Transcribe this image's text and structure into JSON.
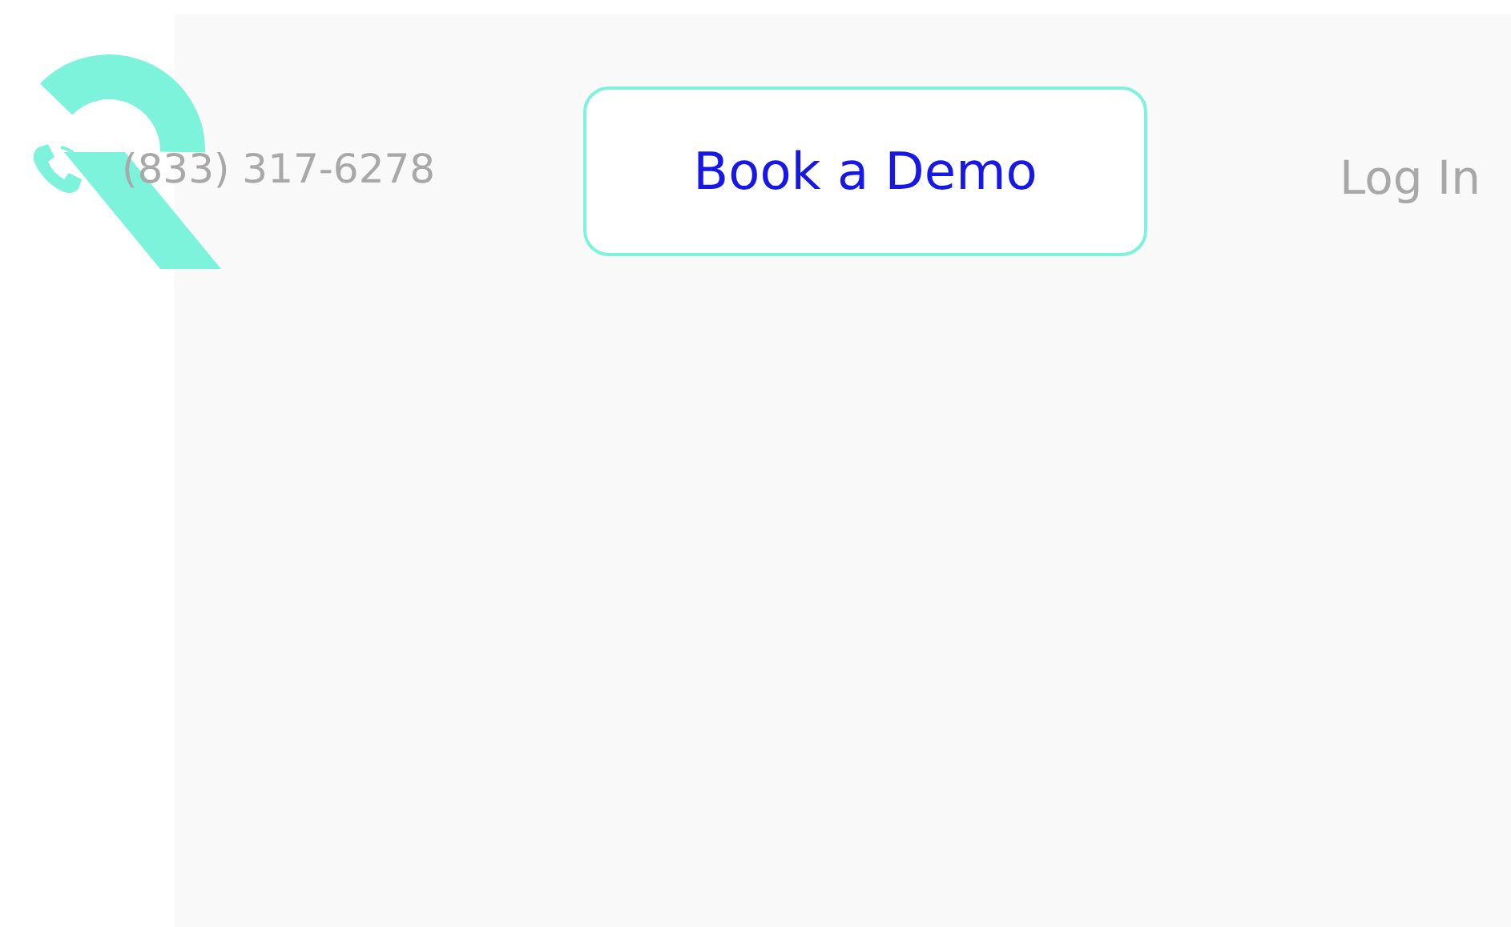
{
  "phone": "(833) 317-6278",
  "cta_button": "Book a Demo",
  "login_link": "Log In"
}
